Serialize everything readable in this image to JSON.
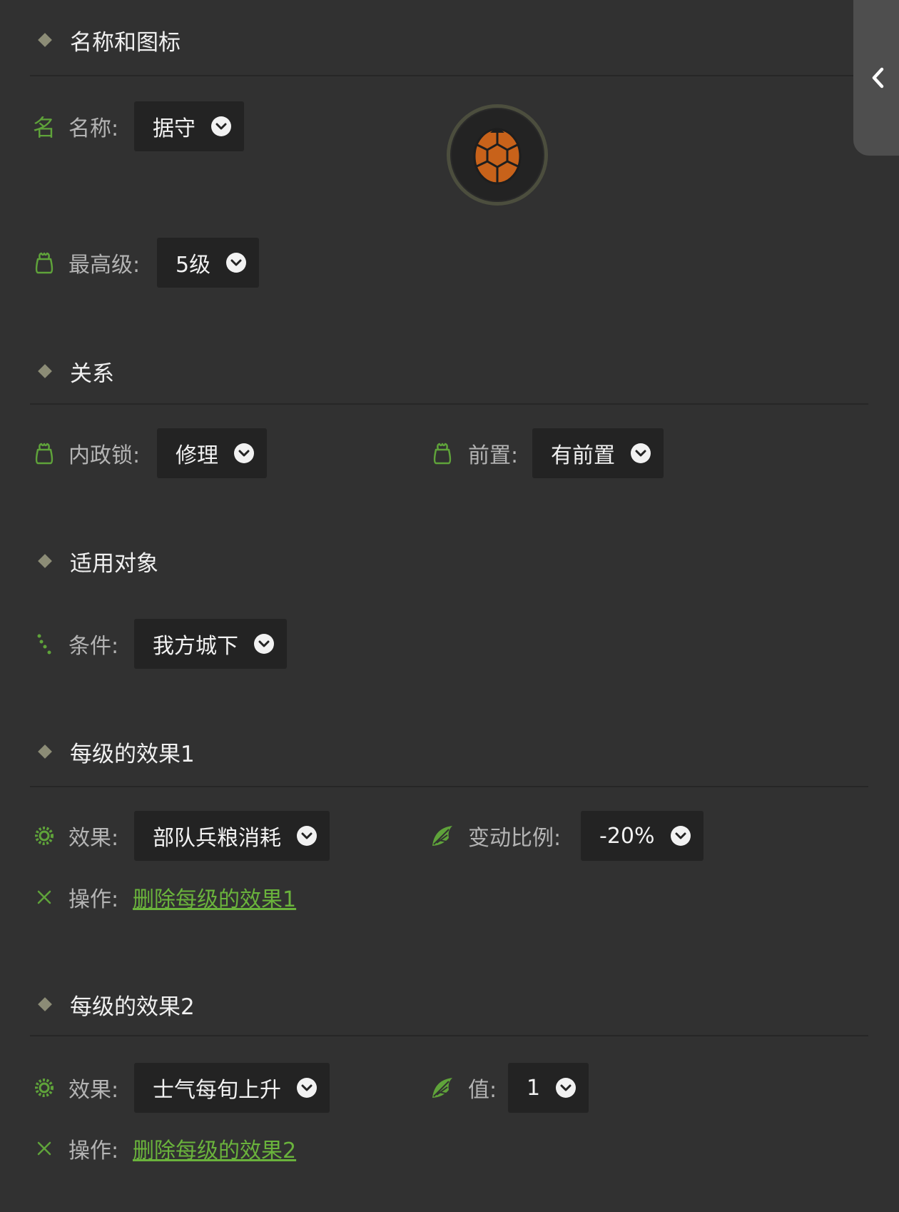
{
  "sections": {
    "name_icon": {
      "title": "名称和图标"
    },
    "relation": {
      "title": "关系"
    },
    "target": {
      "title": "适用对象"
    },
    "effect1": {
      "title": "每级的效果1"
    },
    "effect2": {
      "title": "每级的效果2"
    }
  },
  "name_icon": {
    "name_label": "名称:",
    "name_value": "据守",
    "name_icon": "名",
    "max_level_label": "最高级:",
    "max_level_value": "5级",
    "skill_icon": "turtle-shell-icon"
  },
  "relation": {
    "lock_label": "内政锁:",
    "lock_value": "修理",
    "prereq_label": "前置:",
    "prereq_value": "有前置"
  },
  "target": {
    "condition_label": "条件:",
    "condition_value": "我方城下"
  },
  "effect1": {
    "effect_label": "效果:",
    "effect_value": "部队兵粮消耗",
    "ratio_label": "变动比例:",
    "ratio_value": "-20%",
    "op_label": "操作:",
    "op_link": "删除每级的效果1"
  },
  "effect2": {
    "effect_label": "效果:",
    "effect_value": "士气每旬上升",
    "value_label": "值:",
    "value_value": "1",
    "op_label": "操作:",
    "op_link": "删除每级的效果2"
  },
  "colors": {
    "background": "#313131",
    "accent_green": "#6ab33c",
    "shell_orange": "#c8621a"
  }
}
